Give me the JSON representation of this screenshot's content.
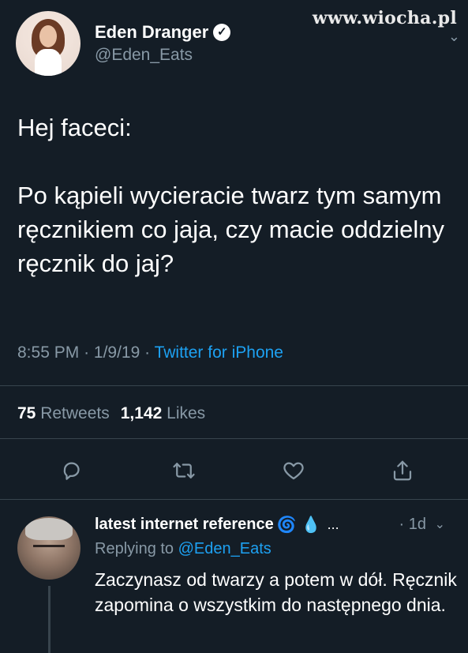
{
  "watermark": "www.wiocha.pl",
  "tweet": {
    "author_name": "Eden Dranger",
    "author_handle": "@Eden_Eats",
    "text_line1": "Hej faceci:",
    "text_line2": "Po kąpieli wycieracie twarz tym samym ręcznikiem co jaja, czy macie oddzielny ręcznik do jaj?",
    "time": "8:55 PM",
    "date": "1/9/19",
    "source": "Twitter for iPhone",
    "retweets_count": "75",
    "retweets_label": "Retweets",
    "likes_count": "1,142",
    "likes_label": "Likes"
  },
  "actions": [
    {
      "name": "reply",
      "icon": "reply-icon"
    },
    {
      "name": "retweet",
      "icon": "retweet-icon"
    },
    {
      "name": "like",
      "icon": "heart-icon"
    },
    {
      "name": "share",
      "icon": "share-icon"
    }
  ],
  "reply": {
    "author_name": "latest internet reference",
    "ellipsis": "...",
    "time": "1d",
    "replying_prefix": "Replying to",
    "replying_handle": "@Eden_Eats",
    "text": "Zaczynasz od twarzy a potem w dół. Ręcznik zapomina o wszystkim do następnego dnia."
  },
  "colors": {
    "background": "#141d26",
    "secondary_text": "#8899a6",
    "link": "#1da1f2",
    "divider": "#38444d"
  }
}
